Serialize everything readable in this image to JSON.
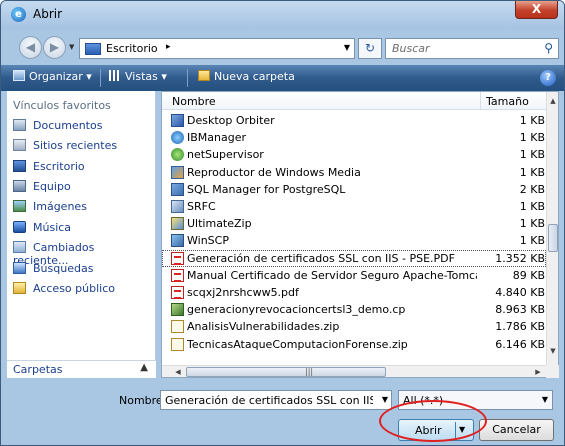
{
  "window": {
    "title": "Abrir",
    "close_label": "X"
  },
  "address": {
    "crumb": "Escritorio",
    "crumb_arrow": "▸"
  },
  "search": {
    "placeholder": "Buscar"
  },
  "toolbar": {
    "organize": "Organizar ▾",
    "views": "Vistas ▾",
    "new_folder": "Nueva carpeta"
  },
  "nav": {
    "header": "Vínculos favoritos",
    "items": [
      {
        "label": "Documentos",
        "icon": "documents-icon"
      },
      {
        "label": "Sitios recientes",
        "icon": "recent-places-icon"
      },
      {
        "label": "Escritorio",
        "icon": "desktop-icon"
      },
      {
        "label": "Equipo",
        "icon": "computer-icon"
      },
      {
        "label": "Imágenes",
        "icon": "pictures-icon"
      },
      {
        "label": "Música",
        "icon": "music-icon"
      },
      {
        "label": "Cambiados reciente...",
        "icon": "recently-changed-icon"
      },
      {
        "label": "Búsquedas",
        "icon": "searches-icon"
      },
      {
        "label": "Acceso público",
        "icon": "public-icon"
      }
    ],
    "footer": "Carpetas"
  },
  "files": {
    "col_name": "Nombre",
    "col_size": "Tamaño",
    "rows": [
      {
        "name": "Desktop Orbiter",
        "size": "1 KB",
        "icon": "app-shortcut-icon"
      },
      {
        "name": "IBManager",
        "size": "1 KB",
        "icon": "app-shortcut-icon"
      },
      {
        "name": "netSupervisor",
        "size": "1 KB",
        "icon": "app-shortcut-icon"
      },
      {
        "name": "Reproductor de Windows Media",
        "size": "1 KB",
        "icon": "app-shortcut-icon"
      },
      {
        "name": "SQL Manager for PostgreSQL",
        "size": "2 KB",
        "icon": "app-shortcut-icon"
      },
      {
        "name": "SRFC",
        "size": "1 KB",
        "icon": "app-shortcut-icon"
      },
      {
        "name": "UltimateZip",
        "size": "1 KB",
        "icon": "app-shortcut-icon"
      },
      {
        "name": "WinSCP",
        "size": "1 KB",
        "icon": "app-shortcut-icon"
      },
      {
        "name": "Generación de certificados SSL con IIS - PSE.PDF",
        "size": "1.352 KB",
        "icon": "pdf-file-icon",
        "selected": true
      },
      {
        "name": "Manual Certificado de Servidor Seguro Apache-Tomcat.p...",
        "size": "89 KB",
        "icon": "pdf-file-icon"
      },
      {
        "name": "scqxj2nrshcww5.pdf",
        "size": "4.840 KB",
        "icon": "pdf-file-icon"
      },
      {
        "name": "generacionyrevocacioncertsl3_demo.cp",
        "size": "8.963 KB",
        "icon": "cp-file-icon"
      },
      {
        "name": "AnalisisVulnerabilidades.zip",
        "size": "1.786 KB",
        "icon": "zip-file-icon"
      },
      {
        "name": "TecnicasAtaqueComputacionForense.zip",
        "size": "6.146 KB",
        "icon": "zip-file-icon"
      }
    ]
  },
  "bottom": {
    "name_label": "Nombre:",
    "name_value": "Generación de certificados SSL con IIS - PSE.F",
    "filter_value": "All (*.*)",
    "open_label": "Abrir",
    "cancel_label": "Cancelar"
  },
  "colors": {
    "accent": "#2f5a8c",
    "highlight": "#e02020"
  }
}
